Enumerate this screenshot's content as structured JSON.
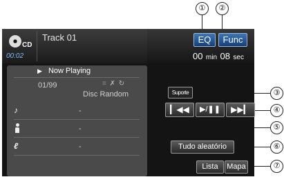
{
  "callouts": [
    "①",
    "②",
    "③",
    "④",
    "⑤",
    "⑥",
    "⑦"
  ],
  "header": {
    "source_label": "CD",
    "elapsed": "00:02",
    "track_label": "Track",
    "track_number": "01",
    "eq_label": "EQ",
    "func_label": "Func",
    "time_min": "00",
    "time_min_unit": "min",
    "time_sec": "08",
    "time_sec_unit": "sec"
  },
  "panel": {
    "title": "Now Playing",
    "count": "01/99",
    "mode": "Disc Random",
    "song": "-",
    "artist": "-",
    "album": "-"
  },
  "controls": {
    "suporte_label": "Suporte",
    "random_all_label": "Tudo aleatório",
    "list_label": "Lista",
    "map_label": "Mapa"
  }
}
